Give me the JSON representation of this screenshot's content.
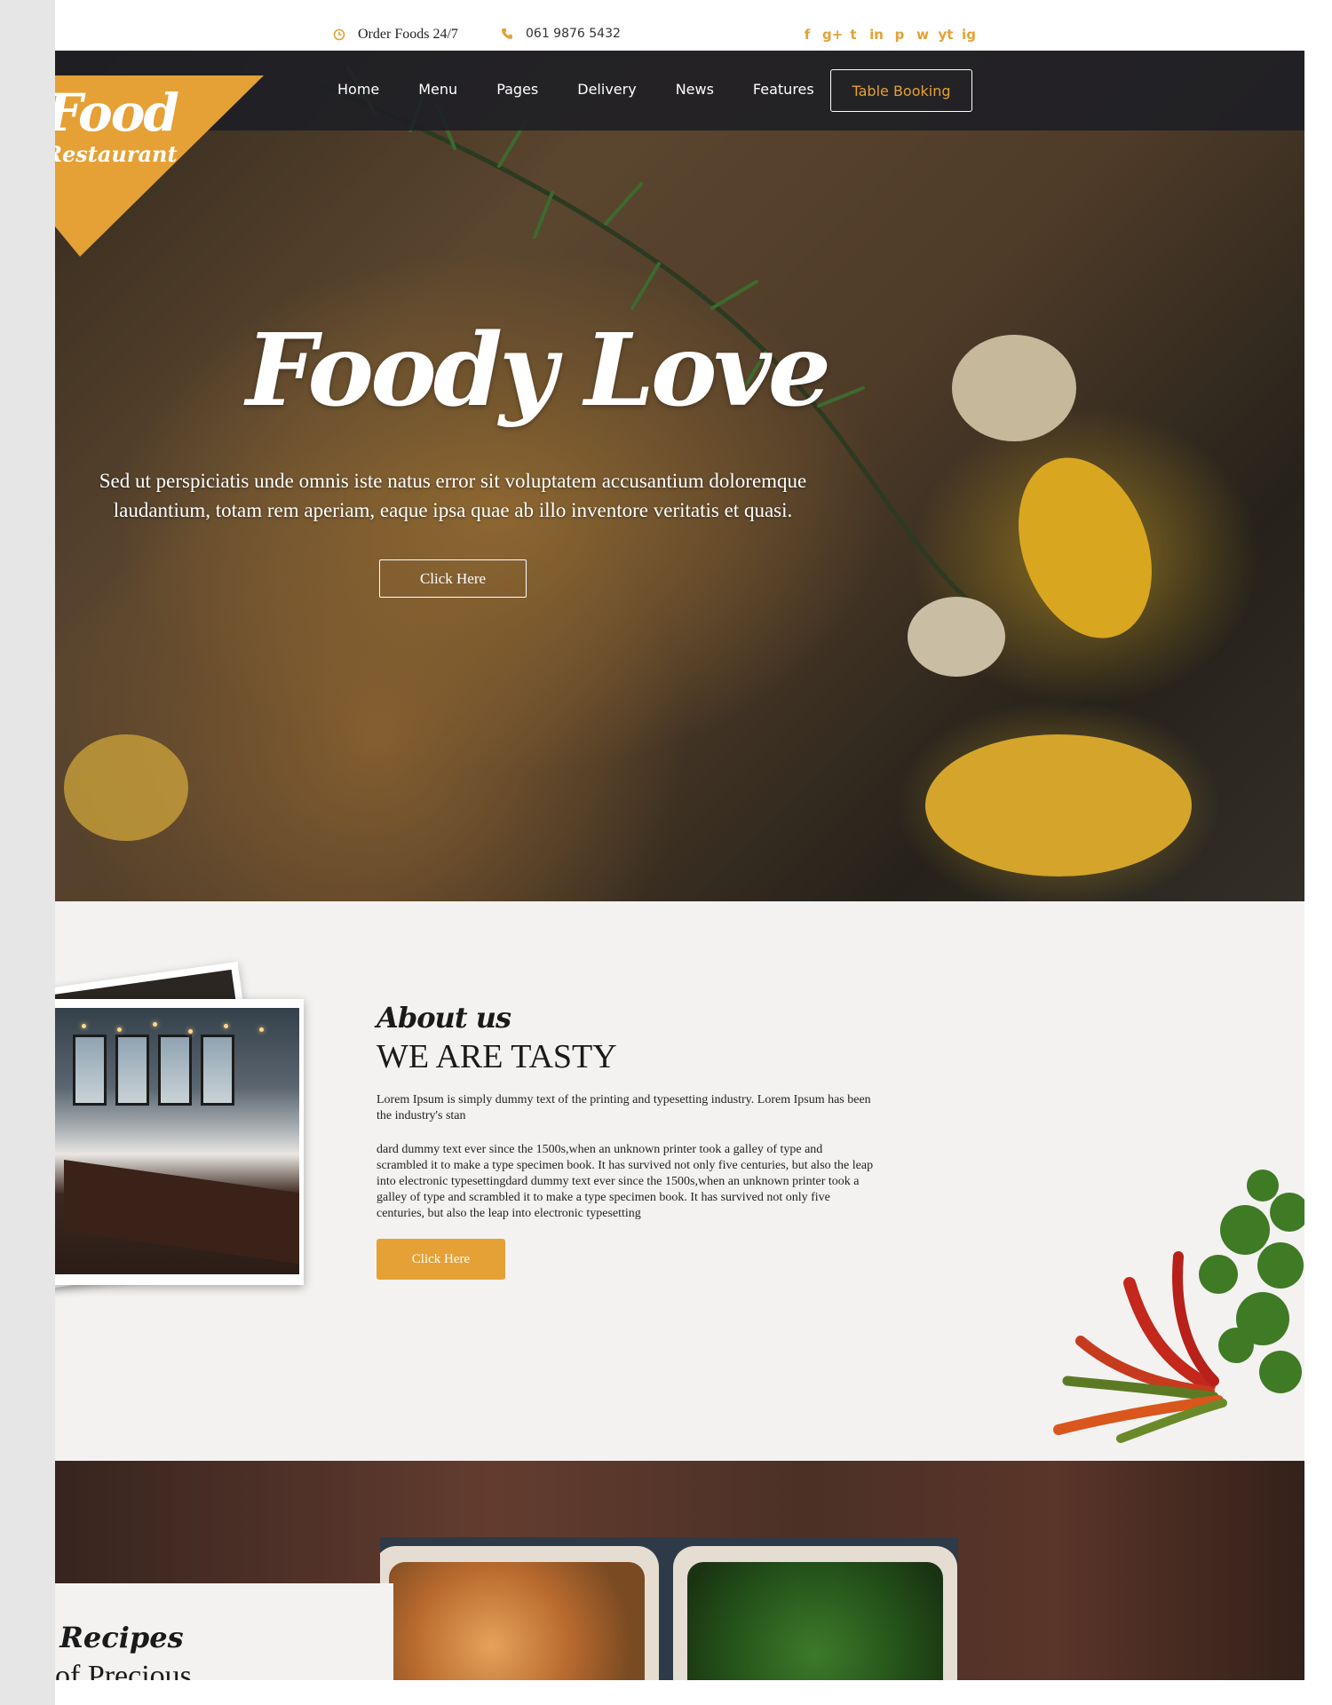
{
  "topbar": {
    "order_text": "Order Foods 24/7",
    "phone": "061 9876 5432",
    "social_icons": [
      "facebook-icon",
      "google-plus-icon",
      "twitter-icon",
      "linkedin-icon",
      "pinterest-icon",
      "whatsapp-icon",
      "youtube-icon",
      "instagram-icon"
    ],
    "social_glyphs": [
      "f",
      "g+",
      "t",
      "in",
      "p",
      "w",
      "yt",
      "ig"
    ]
  },
  "logo": {
    "line1": "Food",
    "line2": "Restaurant"
  },
  "nav": {
    "items": [
      "Home",
      "Menu",
      "Pages",
      "Delivery",
      "News",
      "Features"
    ],
    "booking_label": "Table Booking"
  },
  "hero": {
    "title": "Foody Love",
    "text": "Sed ut perspiciatis unde omnis iste natus error sit voluptatem accusantium doloremque laudantium, totam rem aperiam, eaque ipsa quae ab illo inventore veritatis et quasi.",
    "button_label": "Click Here"
  },
  "about": {
    "subtitle": "About us",
    "title": "WE ARE TASTY",
    "paragraph1": "Lorem Ipsum is simply dummy text of the printing and typesetting industry. Lorem Ipsum has been the industry's stan",
    "paragraph2": "dard dummy text ever since the 1500s,when an unknown printer took a galley of type and scrambled it to make a type specimen book. It has survived not only five centuries, but also the leap into electronic typesettingdard dummy text ever since the 1500s,when an unknown printer took a galley of type and scrambled it to make a type specimen book. It has survived not only five centuries, but also the leap into electronic typesetting",
    "button_label": "Click Here"
  },
  "recipes": {
    "title": "l Recipes",
    "subtitle": "of Precious"
  },
  "colors": {
    "accent": "#e5a135",
    "nav_bg": "#1c1e24",
    "about_bg": "#f3f2f0"
  }
}
